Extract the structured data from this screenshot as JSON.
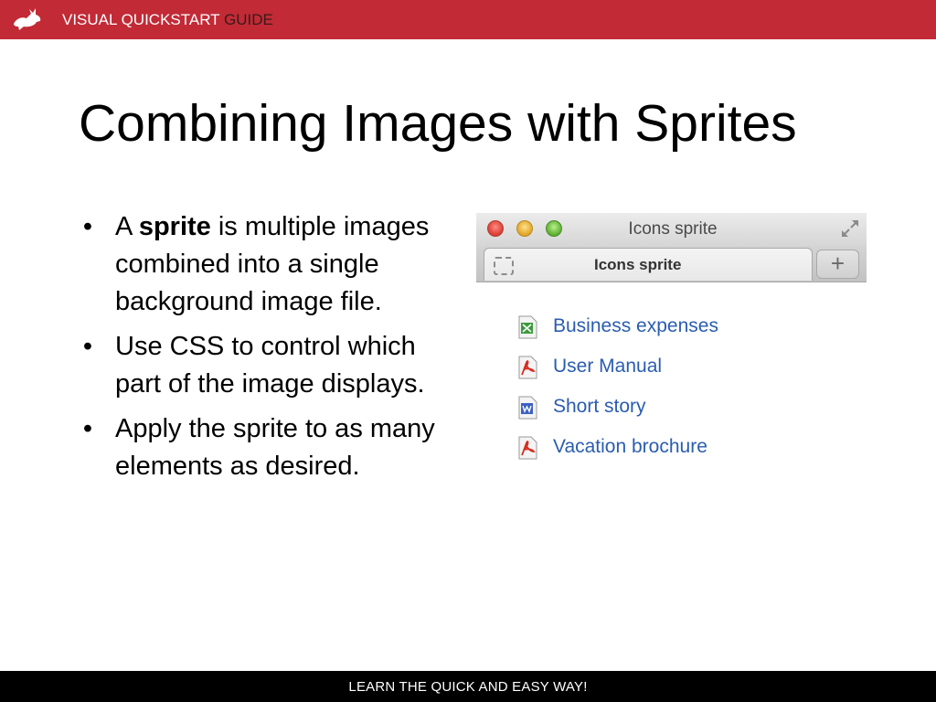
{
  "header": {
    "brand_part1": "VISUAL QUICKSTART",
    "brand_part2": "GUIDE",
    "logo_icon": "rabbit-logo-icon",
    "band_color": "#c22a36"
  },
  "slide": {
    "title": "Combining Images with Sprites",
    "bullets": [
      {
        "prefix": "A ",
        "bold": "sprite",
        "suffix": " is multiple images combined into a single background image file."
      },
      {
        "text": "Use CSS to control which part of the image displays."
      },
      {
        "text": "Apply the sprite to as many elements as desired."
      }
    ]
  },
  "browser": {
    "window_title": "Icons sprite",
    "tab_label": "Icons sprite",
    "new_tab_label": "+",
    "links": [
      {
        "label": "Business expenses",
        "icon": "spreadsheet-icon"
      },
      {
        "label": "User Manual",
        "icon": "pdf-icon"
      },
      {
        "label": "Short story",
        "icon": "word-doc-icon"
      },
      {
        "label": "Vacation brochure",
        "icon": "pdf-icon"
      }
    ],
    "link_color": "#2a5db0"
  },
  "footer": {
    "tagline": "LEARN THE QUICK AND EASY WAY!"
  }
}
